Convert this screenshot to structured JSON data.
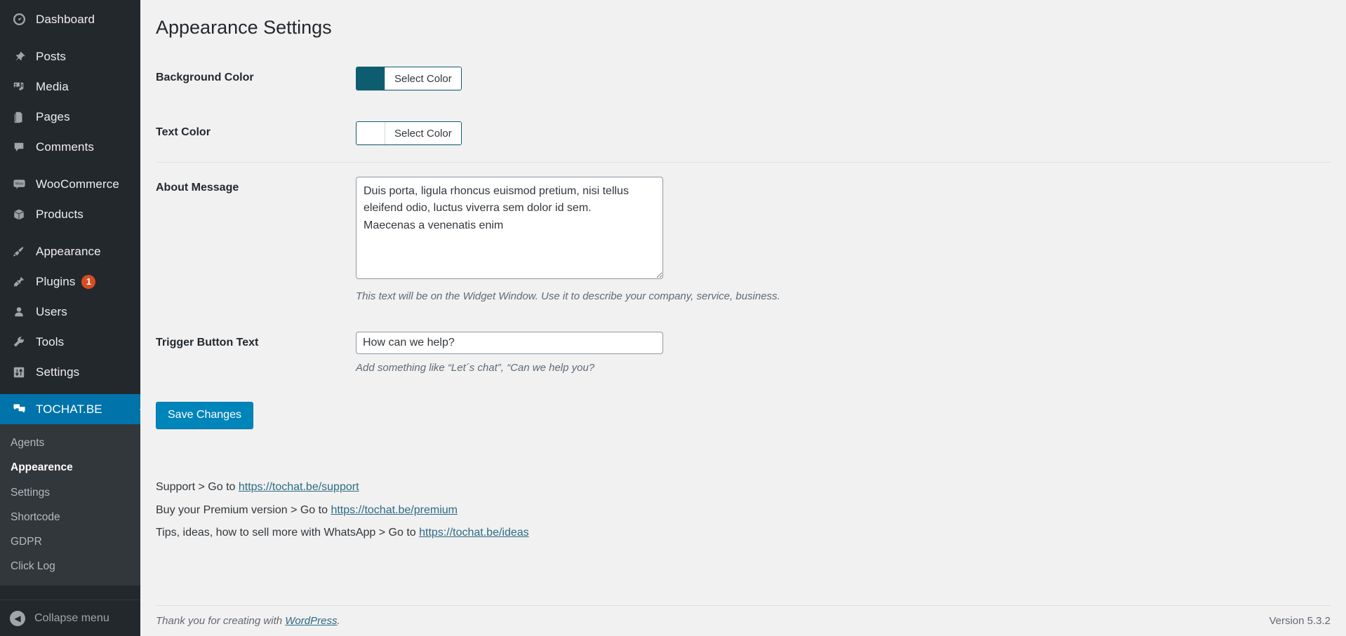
{
  "sidebar": {
    "items": [
      {
        "label": "Dashboard",
        "icon": "dashboard-icon",
        "name": "dashboard"
      },
      {
        "label": "Posts",
        "icon": "pin-icon",
        "name": "posts"
      },
      {
        "label": "Media",
        "icon": "media-icon",
        "name": "media"
      },
      {
        "label": "Pages",
        "icon": "pages-icon",
        "name": "pages"
      },
      {
        "label": "Comments",
        "icon": "comment-icon",
        "name": "comments"
      },
      {
        "label": "WooCommerce",
        "icon": "woo-icon",
        "name": "woocommerce"
      },
      {
        "label": "Products",
        "icon": "box-icon",
        "name": "products"
      },
      {
        "label": "Appearance",
        "icon": "brush-icon",
        "name": "appearance"
      },
      {
        "label": "Plugins",
        "icon": "plug-icon",
        "name": "plugins",
        "badge": "1"
      },
      {
        "label": "Users",
        "icon": "user-icon",
        "name": "users"
      },
      {
        "label": "Tools",
        "icon": "wrench-icon",
        "name": "tools"
      },
      {
        "label": "Settings",
        "icon": "sliders-icon",
        "name": "settings"
      }
    ],
    "active_plugin": {
      "label": "TOCHAT.BE",
      "icon": "chat-bubbles-icon"
    },
    "submenu": [
      {
        "label": "Agents",
        "current": false
      },
      {
        "label": "Appearence",
        "current": true
      },
      {
        "label": "Settings",
        "current": false
      },
      {
        "label": "Shortcode",
        "current": false
      },
      {
        "label": "GDPR",
        "current": false
      },
      {
        "label": "Click Log",
        "current": false
      }
    ],
    "collapse_label": "Collapse menu"
  },
  "page": {
    "title": "Appearance Settings"
  },
  "fields": {
    "background_color": {
      "label": "Background Color",
      "button_label": "Select Color",
      "value": "#0d5c70"
    },
    "text_color": {
      "label": "Text Color",
      "button_label": "Select Color",
      "value": "#ffffff"
    },
    "about_message": {
      "label": "About Message",
      "value": "Duis porta, ligula rhoncus euismod pretium, nisi tellus eleifend odio, luctus viverra sem dolor id sem.\nMaecenas a venenatis enim",
      "hint": "This text will be on the Widget Window. Use it to describe your company, service, business."
    },
    "trigger_button_text": {
      "label": "Trigger Button Text",
      "value": "How can we help?",
      "hint": "Add something like “Let´s chat”, “Can we help you?"
    }
  },
  "actions": {
    "save_label": "Save Changes"
  },
  "support": {
    "line1_prefix": "Support > Go to ",
    "line1_link": "https://tochat.be/support",
    "line2_prefix": "Buy your Premium version > Go to ",
    "line2_link": "https://tochat.be/premium",
    "line3_prefix": "Tips, ideas, how to sell more with WhatsApp > Go to ",
    "line3_link": "https://tochat.be/ideas"
  },
  "footer": {
    "thanks_prefix": "Thank you for creating with ",
    "thanks_link": "WordPress",
    "thanks_suffix": ".",
    "version": "Version 5.3.2"
  },
  "colors": {
    "admin_bg": "#23282d",
    "submenu_bg": "#32373c",
    "accent": "#0073aa",
    "button": "#0085ba",
    "badge": "#d54e21"
  }
}
